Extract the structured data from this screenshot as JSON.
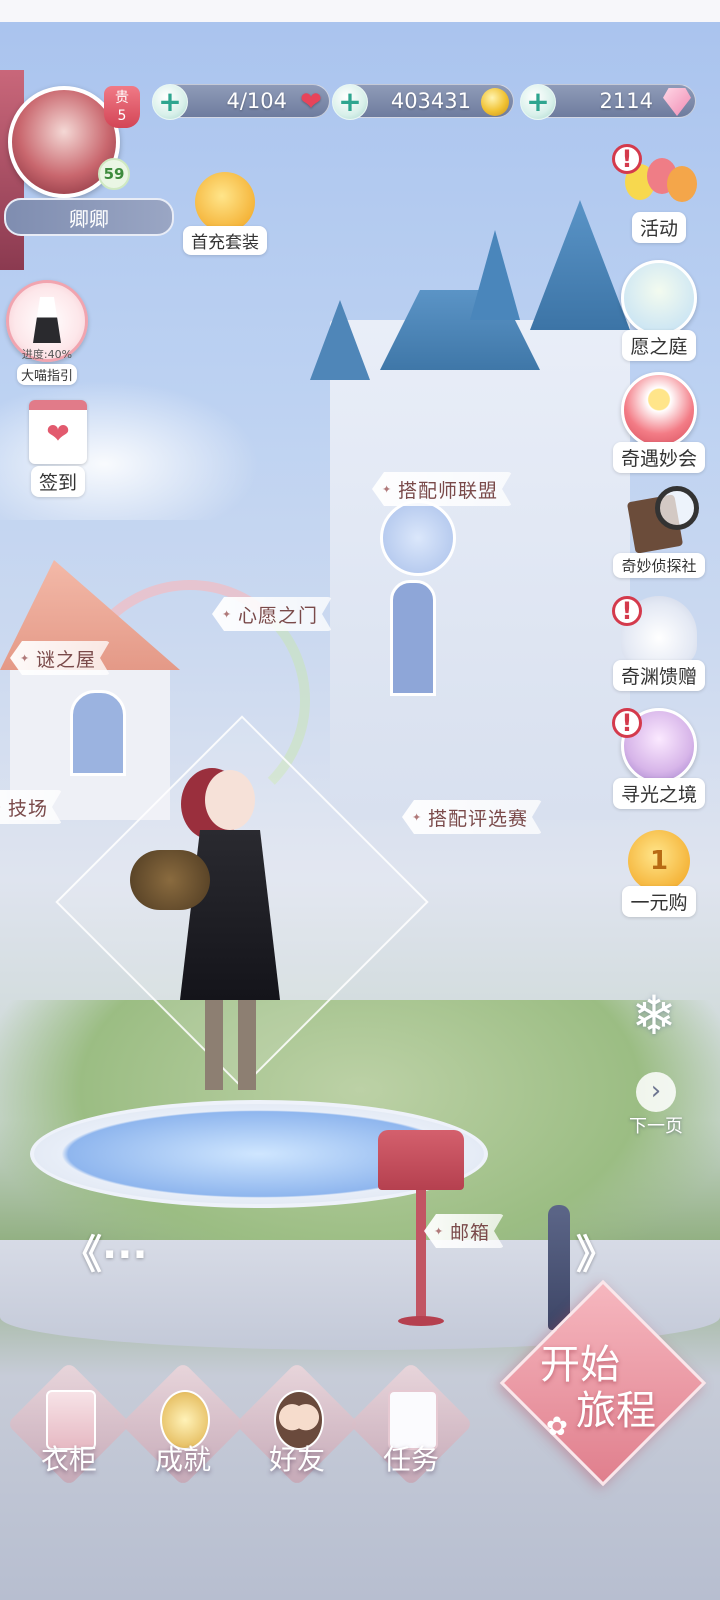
{
  "status": {
    "stamina": "4/104",
    "gold": "403431",
    "diamonds": "2114"
  },
  "player": {
    "vip_label": "贵",
    "vip_level": "5",
    "level": "59",
    "name": "卿卿"
  },
  "left_menu": {
    "first_charge": "首充套装",
    "guide_progress": "进度:40%",
    "guide_label": "大喵指引",
    "checkin": "签到"
  },
  "right_menu": {
    "activity": "活动",
    "wish_garden": "愿之庭",
    "encounter": "奇遇妙会",
    "detective": "奇妙侦探社",
    "abyss_gift": "奇渊馈赠",
    "light_realm": "寻光之境",
    "one_yuan": "一元购",
    "next_page": "下一页"
  },
  "locations": {
    "stylist_league": "搭配师联盟",
    "wish_gate": "心愿之门",
    "mystery_house": "谜之屋",
    "arena": "技场",
    "style_contest": "搭配评选赛",
    "mailbox": "邮箱"
  },
  "bottom_nav": {
    "wardrobe": "衣柜",
    "achievement": "成就",
    "friends": "好友",
    "tasks": "任务"
  },
  "start": {
    "line1": "开始",
    "line2": "旅程"
  },
  "nav_arrows": {
    "left": "《···",
    "right": "》"
  },
  "colors": {
    "accent_pink": "#e07f8d",
    "bar_blue": "#7d8aab",
    "plus_green": "#2ea58f"
  }
}
